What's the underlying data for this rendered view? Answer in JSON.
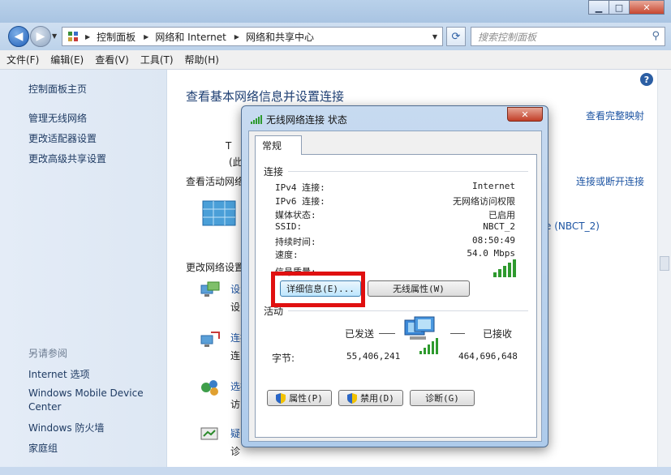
{
  "window": {
    "minimize": "▁",
    "maximize": "□",
    "close": "✕"
  },
  "address": {
    "crumbs": [
      "控制面板",
      "网络和 Internet",
      "网络和共享中心"
    ],
    "search_placeholder": "搜索控制面板"
  },
  "menu": [
    "文件(F)",
    "编辑(E)",
    "查看(V)",
    "工具(T)",
    "帮助(H)"
  ],
  "sidebar": {
    "home": "控制面板主页",
    "items": [
      "管理无线网络",
      "更改适配器设置",
      "更改高级共享设置"
    ],
    "see_also_title": "另请参阅",
    "see_also": [
      "Internet 选项",
      "Windows Mobile Device",
      "Center",
      "Windows 防火墙",
      "家庭组"
    ]
  },
  "main": {
    "title": "查看基本网络信息并设置连接",
    "full_map": "查看完整映射",
    "active_networks": "查看活动网络",
    "connect_disconnect": "连接或断开连接",
    "connection_link": "e (NBCT_2)",
    "change_settings": "更改网络设置",
    "partial_t": "T",
    "partial_paren": "(此",
    "partial_items": [
      "设置",
      "设",
      "连接",
      "连",
      "选择",
      "访问",
      "疑",
      "诊"
    ]
  },
  "dialog": {
    "title": "无线网络连接 状态",
    "close": "✕",
    "tab": "常规",
    "connection_group": "连接",
    "rows": [
      {
        "k": "IPv4 连接:",
        "v": "Internet"
      },
      {
        "k": "IPv6 连接:",
        "v": "无网络访问权限"
      },
      {
        "k": "媒体状态:",
        "v": "已启用"
      },
      {
        "k": "SSID:",
        "v": "NBCT_2"
      },
      {
        "k": "持续时间:",
        "v": "08:50:49"
      },
      {
        "k": "速度:",
        "v": "54.0 Mbps"
      }
    ],
    "signal_label": "信号质量:",
    "details_btn": "详细信息(E)...",
    "wireless_props_btn": "无线属性(W)",
    "activity_group": "活动",
    "sent_label": "已发送",
    "received_label": "已接收",
    "bytes_label": "字节:",
    "bytes_sent": "55,406,241",
    "bytes_received": "464,696,648",
    "properties_btn": "属性(P)",
    "disable_btn": "禁用(D)",
    "diagnose_btn": "诊断(G)"
  }
}
